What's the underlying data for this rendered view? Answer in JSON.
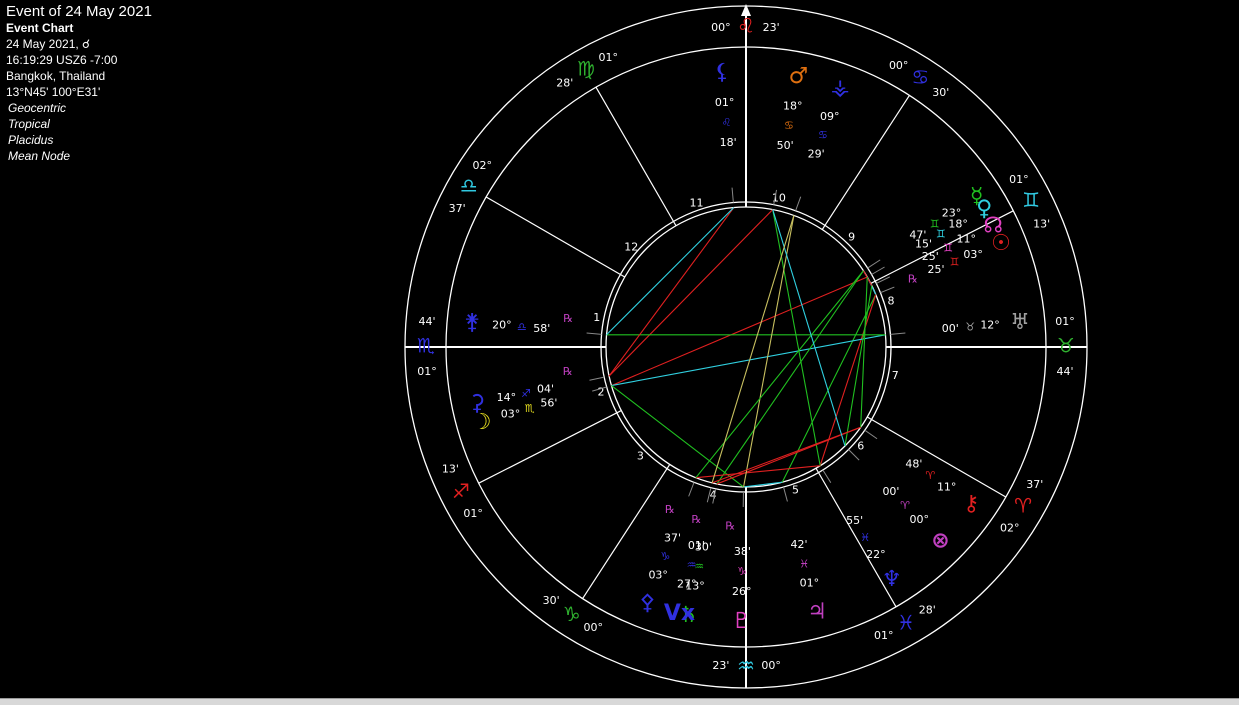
{
  "header": {
    "title": "Event of 24 May 2021",
    "chart_type": "Event Chart",
    "date_line": "24 May 2021, ☌",
    "time_line": "16:19:29  USZ6 -7:00",
    "place": "Bangkok, Thailand",
    "coords": "13°N45' 100°E31'",
    "options": [
      "Geocentric",
      "Tropical",
      "Placidus",
      "Mean Node"
    ]
  },
  "colors": {
    "background": "#000000",
    "lines": "#ffffff",
    "fire": "#e02020",
    "earth": "#2fb02f",
    "air": "#30c8e0",
    "water": "#3030e0",
    "retro": "#c040c0",
    "aspect_red": "#e02020",
    "aspect_green": "#20c020",
    "aspect_cyan": "#30d0e0",
    "aspect_yellow": "#c8c060"
  },
  "house_numbers": [
    "10",
    "9",
    "8",
    "7",
    "6",
    "5",
    "4",
    "3",
    "2",
    "1",
    "12",
    "11"
  ],
  "cusps": [
    {
      "deg": "00°",
      "sym": "♌",
      "min": "23'",
      "c": "#e02020"
    },
    {
      "deg": "00°",
      "sym": "♋",
      "min": "30'",
      "c": "#3030e0"
    },
    {
      "deg": "01°",
      "sym": "♊",
      "min": "13'",
      "c": "#30c8e0"
    },
    {
      "deg": "01°",
      "sym": "♉",
      "min": "44'",
      "c": "#2fb02f"
    },
    {
      "deg": "37'",
      "sym": "♈",
      "min": "02°",
      "c": "#e02020"
    },
    {
      "deg": "28'",
      "sym": "♓",
      "min": "01°",
      "c": "#3030e0"
    },
    {
      "deg": "00°",
      "sym": "♒",
      "min": "23'",
      "c": "#30c8e0"
    },
    {
      "deg": "00°",
      "sym": "♑",
      "min": "30'",
      "c": "#2fb02f"
    },
    {
      "deg": "01°",
      "sym": "♐",
      "min": "13'",
      "c": "#e02020"
    },
    {
      "deg": "01°",
      "sym": "♏",
      "min": "44'",
      "c": "#3030e0"
    },
    {
      "deg": "37'",
      "sym": "♎",
      "min": "02°",
      "c": "#30c8e0"
    },
    {
      "deg": "28'",
      "sym": "♍",
      "min": "01°",
      "c": "#2fb02f"
    }
  ],
  "planets": [
    {
      "name": "Sun",
      "glyph": "☉",
      "c": "#e02020",
      "sign": "♊",
      "deg": "03°",
      "min": "25'",
      "r": ""
    },
    {
      "name": "Moon",
      "glyph": "☽",
      "c": "#e8e020",
      "sign": "♏",
      "deg": "03°",
      "min": "56'",
      "r": ""
    },
    {
      "name": "Mercury",
      "glyph": "☿",
      "c": "#20c020",
      "sign": "♊",
      "deg": "23°",
      "min": "47'",
      "r": ""
    },
    {
      "name": "Venus",
      "glyph": "♀",
      "c": "#30d0e0",
      "sign": "♊",
      "deg": "18°",
      "min": "15'",
      "r": ""
    },
    {
      "name": "Mars",
      "glyph": "♂",
      "c": "#e07010",
      "sign": "♋",
      "deg": "18°",
      "min": "50'",
      "r": ""
    },
    {
      "name": "Jupiter",
      "glyph": "♃",
      "c": "#c040c0",
      "sign": "♓",
      "deg": "01°",
      "min": "42'",
      "r": ""
    },
    {
      "name": "Saturn",
      "glyph": "♄",
      "c": "#20c020",
      "sign": "♒",
      "deg": "13°",
      "min": "30'",
      "r": "℞"
    },
    {
      "name": "Uranus",
      "glyph": "♅",
      "c": "#a0a0a0",
      "sign": "♉",
      "deg": "12°",
      "min": "00'",
      "r": ""
    },
    {
      "name": "Neptune",
      "glyph": "♆",
      "c": "#3030e0",
      "sign": "♓",
      "deg": "22°",
      "min": "55'",
      "r": ""
    },
    {
      "name": "Pluto",
      "glyph": "♇",
      "c": "#e040c0",
      "sign": "♑",
      "deg": "26°",
      "min": "38'",
      "r": "℞"
    },
    {
      "name": "Node",
      "glyph": "☊",
      "c": "#e040c0",
      "sign": "♊",
      "deg": "11°",
      "min": "25'",
      "r": "℞"
    },
    {
      "name": "Chiron",
      "glyph": "⚷",
      "c": "#e02020",
      "sign": "♈",
      "deg": "11°",
      "min": "48'",
      "r": ""
    },
    {
      "name": "Ceres",
      "glyph": "⚳",
      "c": "#3030e0",
      "sign": "♐",
      "deg": "14°",
      "min": "04'",
      "r": "℞"
    },
    {
      "name": "Juno",
      "glyph": "⚵",
      "c": "#3030e0",
      "sign": "♎",
      "deg": "20°",
      "min": "58'",
      "r": "℞"
    },
    {
      "name": "Pallas",
      "glyph": "⚴",
      "c": "#3030e0",
      "sign": "♑",
      "deg": "03°",
      "min": "37'",
      "r": "℞"
    },
    {
      "name": "Vesta",
      "glyph": "⚶",
      "c": "#3030e0",
      "sign": "♋",
      "deg": "09°",
      "min": "29'",
      "r": ""
    },
    {
      "name": "Fortune",
      "glyph": "⊗",
      "c": "#c040c0",
      "sign": "♈",
      "deg": "00°",
      "min": "00'",
      "r": ""
    },
    {
      "name": "Vertex",
      "glyph": "Vx",
      "c": "#3030e0",
      "sign": "♒",
      "deg": "27°",
      "min": "01'",
      "r": ""
    },
    {
      "name": "Lilith",
      "glyph": "⚸",
      "c": "#3030e0",
      "sign": "♌",
      "deg": "01°",
      "min": "18'",
      "r": ""
    }
  ],
  "aspects": [
    {
      "a": 0,
      "b": 3,
      "c": "#30d0e0"
    },
    {
      "a": 0,
      "b": 5,
      "c": "#20c020"
    },
    {
      "a": 0,
      "b": 8,
      "c": "#e02020"
    },
    {
      "a": 1,
      "b": 3,
      "c": "#e02020"
    },
    {
      "a": 1,
      "b": 7,
      "c": "#30d0e0"
    },
    {
      "a": 1,
      "b": 9,
      "c": "#20c020"
    },
    {
      "a": 2,
      "b": 6,
      "c": "#20c020"
    },
    {
      "a": 2,
      "b": 10,
      "c": "#e02020"
    },
    {
      "a": 3,
      "b": 11,
      "c": "#20c020"
    },
    {
      "a": 4,
      "b": 8,
      "c": "#20c020"
    },
    {
      "a": 4,
      "b": 12,
      "c": "#e02020"
    },
    {
      "a": 5,
      "b": 9,
      "c": "#30d0e0"
    },
    {
      "a": 6,
      "b": 11,
      "c": "#e02020"
    },
    {
      "a": 7,
      "b": 13,
      "c": "#20c020"
    },
    {
      "a": 8,
      "b": 14,
      "c": "#e02020"
    },
    {
      "a": 9,
      "b": 15,
      "c": "#c8c060"
    },
    {
      "a": 10,
      "b": 16,
      "c": "#20c020"
    },
    {
      "a": 11,
      "b": 17,
      "c": "#e02020"
    },
    {
      "a": 2,
      "b": 14,
      "c": "#20c020"
    },
    {
      "a": 4,
      "b": 16,
      "c": "#30d0e0"
    },
    {
      "a": 12,
      "b": 18,
      "c": "#e02020"
    },
    {
      "a": 13,
      "b": 18,
      "c": "#30d0e0"
    },
    {
      "a": 15,
      "b": 17,
      "c": "#c8c060"
    }
  ]
}
